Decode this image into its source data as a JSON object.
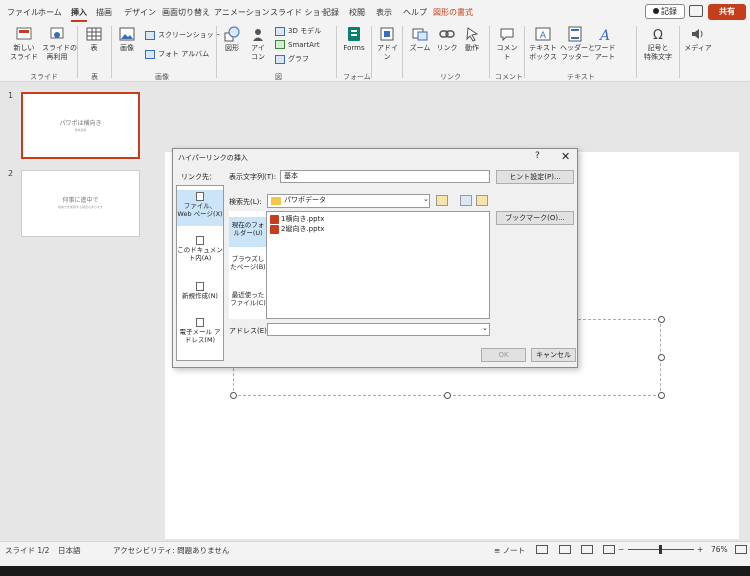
{
  "ribbon_tabs": [
    "ファイル",
    "ホーム",
    "挿入",
    "描画",
    "デザイン",
    "画面切り替え",
    "アニメーション",
    "スライド ショー",
    "記録",
    "校閲",
    "表示",
    "ヘルプ",
    "図形の書式"
  ],
  "header": {
    "record_label": "記録",
    "share_label": "共有"
  },
  "ribbon": {
    "new_slide": "新しい\nスライド",
    "reuse_slide": "スライドの\n再利用",
    "group_slide": "スライド",
    "table": "表",
    "group_table": "表",
    "image": "画像",
    "screenshot": "スクリーンショット",
    "photo_album": "フォト アルバム",
    "group_image": "画像",
    "shapes": "図形",
    "icons": "アイ\nコン",
    "model3d": "3D モデル",
    "smartart": "SmartArt",
    "graph": "グラフ",
    "group_figure": "図",
    "forms": "Forms",
    "group_forms": "フォーム",
    "addin": "アドイ\nン",
    "zoom": "ズーム",
    "link": "リンク",
    "action": "動作",
    "group_link": "リンク",
    "comment": "コメント",
    "group_comment": "コメント",
    "textbox": "テキスト\nボックス",
    "header_footer": "ヘッダーと\nフッター",
    "wordart": "ワード\nアート",
    "group_text": "テキスト",
    "symbol": "記号と\n特殊文字",
    "media": "メディア"
  },
  "slides": [
    {
      "num": "1",
      "title": "パワポは横向き",
      "sub": "基本資料"
    },
    {
      "num": "2",
      "title": "何事に進中で",
      "sub": "縦向きを使用する場合もあります"
    }
  ],
  "dialog": {
    "title": "ハイパーリンクの挿入",
    "help": "?",
    "close": "✕",
    "link_to_label": "リンク先：",
    "display_text_label": "表示文字列(T):",
    "display_text_value": "基本",
    "hint_button": "ヒント設定(P)...",
    "search_label": "検索先(L):",
    "search_value": "パワポデータ",
    "bookmark_button": "ブックマーク(O)...",
    "link_types": [
      "ファイル、Web ページ(X)",
      "このドキュメント内(A)",
      "新規作成(N)",
      "電子メール アドレス(M)"
    ],
    "locations": [
      "現在のフォルダー(U)",
      "ブラウズしたページ(B)",
      "最近使ったファイル(C)"
    ],
    "files": [
      "1横向き.pptx",
      "2縦向き.pptx"
    ],
    "address_label": "アドレス(E):",
    "ok": "OK",
    "cancel": "キャンセル"
  },
  "status": {
    "slide": "スライド 1/2",
    "language": "日本語",
    "accessibility": "アクセシビリティ: 問題ありません",
    "notes": "ノート",
    "zoom": "76%"
  }
}
